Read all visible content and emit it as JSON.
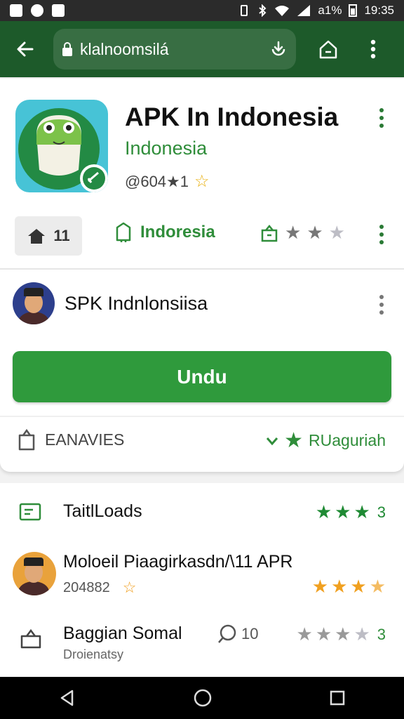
{
  "status_bar": {
    "time": "19:35",
    "battery": "a1%"
  },
  "toolbar": {
    "url": "klalnoomsilá",
    "icons": [
      "back-arrow-icon",
      "lock-icon",
      "download-icon",
      "home-icon",
      "more-vert-icon"
    ]
  },
  "app": {
    "title": "APK In Indonesia",
    "subtitle": "Indonesia",
    "meta": "@604★1"
  },
  "chip": {
    "label": "11"
  },
  "region": {
    "label": "Indoresia"
  },
  "rating_row": {
    "filled": 2,
    "total": 3
  },
  "developer": {
    "name": "SPK Indnlonsiisa"
  },
  "primary_button": {
    "label": "Undu"
  },
  "actions": {
    "left_label": "EANAVIES",
    "right_label": "RUaguriah"
  },
  "list": [
    {
      "title": "TaitlLoads",
      "stars_filled": 3,
      "stars_total": 3,
      "count": "3",
      "star_color": "#1f8a34"
    },
    {
      "title": "Moloeil Piaagirkasdn/\\11 APR",
      "sub": "204882",
      "stars_filled": 3.5,
      "stars_total": 4,
      "star_color": "#f0a020"
    },
    {
      "title": "Baggian Somal",
      "sub": "Droienatsy",
      "comments": "10",
      "stars_filled": 3,
      "stars_total": 4,
      "count": "3",
      "star_color": "#bdbdc5"
    }
  ],
  "colors": {
    "toolbar": "#1d5a2a",
    "accent": "#2f9a3c",
    "accent_text": "#2f8d3a"
  }
}
